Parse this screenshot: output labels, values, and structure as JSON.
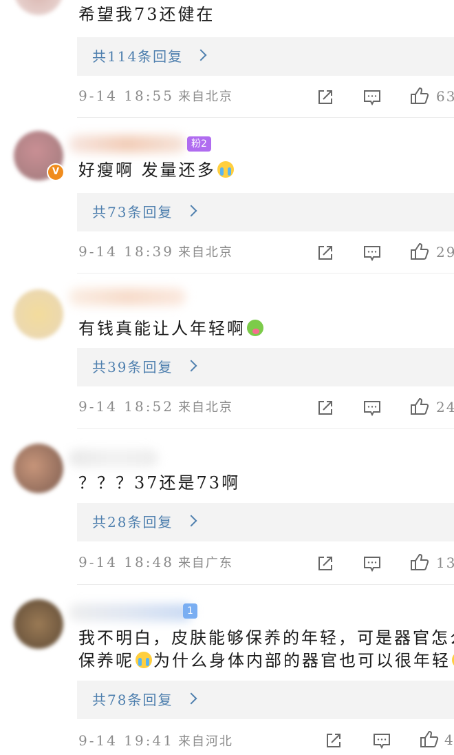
{
  "comments": [
    {
      "text": "希望我73还健在",
      "replies_label": "共114条回复",
      "time": "9-14 18:55",
      "location": "来自北京",
      "likes": "63"
    },
    {
      "fan_badge": "粉2",
      "text": "好瘦啊 发量还多",
      "emoji": "crying-face-icon",
      "replies_label": "共73条回复",
      "time": "9-14 18:39",
      "location": "来自北京",
      "likes": "29"
    },
    {
      "text": "有钱真能让人年轻啊",
      "emoji": "frog-face-icon",
      "replies_label": "共39条回复",
      "time": "9-14 18:52",
      "location": "来自北京",
      "likes": "24"
    },
    {
      "text": "？？？37还是73啊",
      "replies_label": "共28条回复",
      "time": "9-14 18:48",
      "location": "来自广东",
      "likes": "13"
    },
    {
      "fan_badge": "1",
      "text_line1": "我不明白，皮肤能够保养的年轻，可是器官怎么",
      "text_line2_a": "保养呢",
      "text_line2_b": "为什么身体内部的器官也可以很年轻",
      "replies_label": "共78条回复",
      "time": "9-14 19:41",
      "location": "来自河北",
      "likes": "4"
    }
  ],
  "colors": {
    "link": "#4e7fae",
    "meta": "#8a8a8a",
    "reply_bg": "#f3f3f3",
    "v_badge": "#f08c1e",
    "fan_badge_purple": "#b06cf0",
    "fan_badge_blue": "#7aaef2"
  }
}
